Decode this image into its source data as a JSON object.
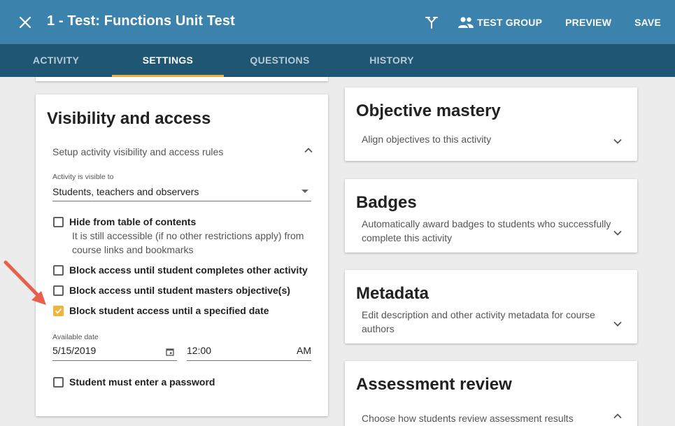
{
  "header": {
    "title": "1 - Test: Functions Unit Test",
    "test_group_label": "TEST GROUP",
    "preview_label": "PREVIEW",
    "save_label": "SAVE"
  },
  "tabs": [
    {
      "label": "ACTIVITY",
      "active": false
    },
    {
      "label": "SETTINGS",
      "active": true
    },
    {
      "label": "QUESTIONS",
      "active": false
    },
    {
      "label": "HISTORY",
      "active": false
    }
  ],
  "visibility": {
    "title": "Visibility and access",
    "description": "Setup activity visibility and access rules",
    "visible_to_label": "Activity is visible to",
    "visible_to_value": "Students, teachers and observers",
    "options": [
      {
        "label": "Hide from table of contents",
        "help": "It is still accessible (if no other restrictions apply) from course links and bookmarks",
        "checked": false
      },
      {
        "label": "Block access until student completes other activity",
        "checked": false
      },
      {
        "label": "Block access until student masters objective(s)",
        "checked": false
      },
      {
        "label": "Block student access until a specified date",
        "checked": true
      }
    ],
    "available_date_label": "Available date",
    "date_value": "5/15/2019",
    "time_value": "12:00",
    "ampm_value": "AM",
    "password_label": "Student must enter a password",
    "password_checked": false
  },
  "side_cards": [
    {
      "title": "Objective mastery",
      "description": "Align objectives to this activity",
      "expanded": false
    },
    {
      "title": "Badges",
      "description": "Automatically award badges to students who successfully complete this activity",
      "expanded": false
    },
    {
      "title": "Metadata",
      "description": "Edit description and other activity metadata for course authors",
      "expanded": false
    },
    {
      "title": "Assessment review",
      "description": "Choose how students review assessment results",
      "expanded": true
    }
  ],
  "colors": {
    "header": "#3b82ad",
    "tabbar": "#1e5673",
    "accent": "#f0b43c",
    "annotation_arrow": "#e8604c"
  }
}
